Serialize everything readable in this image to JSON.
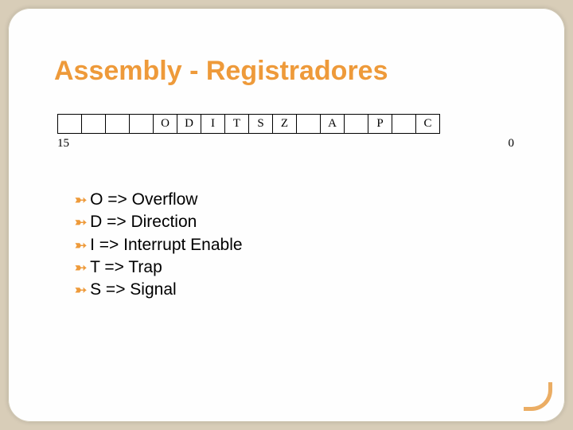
{
  "title": "Assembly - Registradores",
  "flag_register": {
    "cells": [
      "",
      "",
      "",
      "",
      "O",
      "D",
      "I",
      "T",
      "S",
      "Z",
      "",
      "A",
      "",
      "P",
      "",
      "C"
    ],
    "left_label": "15",
    "right_label": "0"
  },
  "bullets": [
    "O => Overflow",
    "D => Direction",
    "I => Interrupt Enable",
    "T => Trap",
    "S => Signal"
  ]
}
